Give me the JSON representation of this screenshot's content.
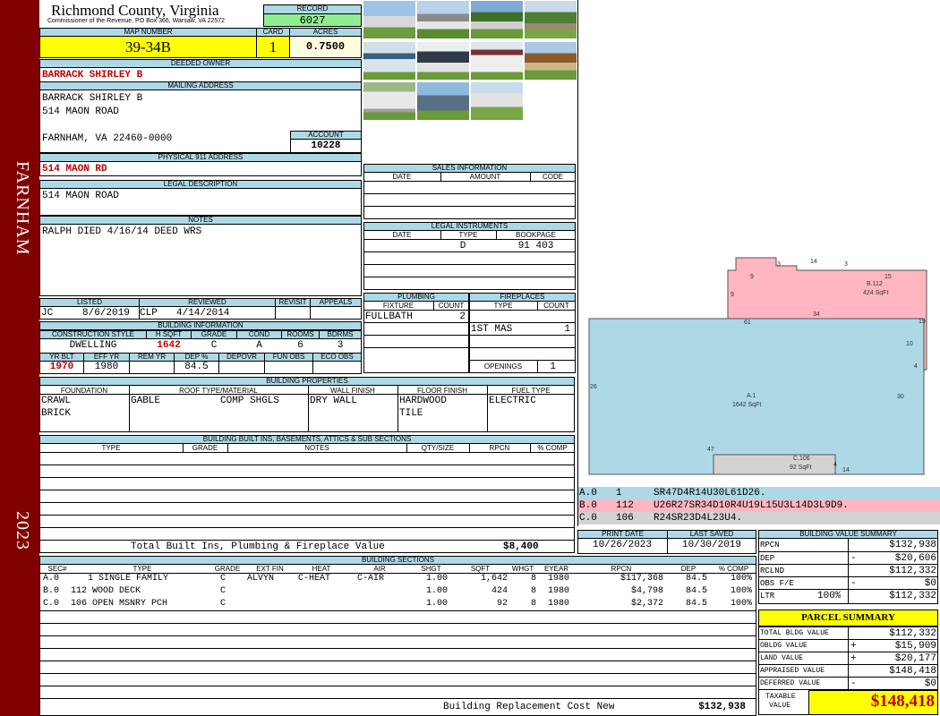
{
  "sidebar": {
    "town": "FARNHAM",
    "year": "2023"
  },
  "header": {
    "county": "Richmond County, Virginia",
    "commissioner": "Commissioner of the Revenue, PO Box 366, Warsaw, VA 22572",
    "record_label": "RECORD",
    "record": "6027"
  },
  "parcel": {
    "map_number_label": "MAP NUMBER",
    "map_number": "39-34B",
    "card_label": "CARD",
    "card": "1",
    "acres_label": "ACRES",
    "acres": "0.7500"
  },
  "owner": {
    "deeded_owner_label": "DEEDED OWNER",
    "deeded_owner": "BARRACK SHIRLEY B",
    "mailing_label": "MAILING ADDRESS",
    "mailing_line1": "BARRACK SHIRLEY B",
    "mailing_line2": "514 MAON ROAD",
    "mailing_line3": "FARNHAM, VA 22460-0000",
    "account_label": "ACCOUNT",
    "account": "10228"
  },
  "physical": {
    "label": "PHYSICAL 911 ADDRESS",
    "value": "514 MAON RD"
  },
  "legal": {
    "label": "LEGAL DESCRIPTION",
    "value": "514 MAON ROAD"
  },
  "notes": {
    "label": "NOTES",
    "value": "RALPH DIED 4/16/14 DEED WRS"
  },
  "review": {
    "listed_label": "LISTED",
    "reviewed_label": "REVIEWED",
    "revisit_label": "REVISIT",
    "appeals_label": "APPEALS",
    "listed_by": "JC",
    "listed_date": "8/6/2019",
    "reviewed_by": "CLP",
    "reviewed_date": "4/14/2014"
  },
  "building_info": {
    "label": "BUILDING INFORMATION",
    "construction_style_label": "CONSTRUCTION STYLE",
    "hsqft_label": "H SQFT",
    "grade_label": "GRADE",
    "cond_label": "COND",
    "rooms_label": "ROOMS",
    "bdrms_label": "BDRMS",
    "construction_style": "DWELLING",
    "hsqft": "1642",
    "grade": "C",
    "cond": "A",
    "rooms": "6",
    "bdrms": "3",
    "yrblt_label": "YR BLT",
    "effyr_label": "EFF YR",
    "remyr_label": "REM YR",
    "dep_label": "DEP %",
    "depovr_label": "DEPOVR",
    "funobs_label": "FUN OBS",
    "ecoobs_label": "ECO OBS",
    "yrblt": "1970",
    "effyr": "1980",
    "dep": "84.5"
  },
  "building_props": {
    "label": "BUILDING PROPERTIES",
    "foundation_label": "FOUNDATION",
    "roof_label": "ROOF TYPE/MATERIAL",
    "wall_label": "WALL FINISH",
    "floor_label": "FLOOR FINISH",
    "fuel_label": "FUEL TYPE",
    "foundation1": "CRAWL",
    "foundation2": "BRICK",
    "roof_type": "GABLE",
    "roof_material": "COMP SHGLS",
    "wall": "DRY WALL",
    "floor1": "HARDWOOD",
    "floor2": "TILE",
    "fuel": "ELECTRIC"
  },
  "builtins": {
    "label": "BUILDING BUILT INS, BASEMENTS, ATTICS & SUB SECTIONS",
    "type_label": "TYPE",
    "grade_label": "GRADE",
    "notes_label": "NOTES",
    "qty_label": "QTY/SIZE",
    "rpcn_label": "RPCN",
    "pcomp_label": "% COMP",
    "total_label": "Total Built Ins, Plumbing & Fireplace Value",
    "total_value": "$8,400"
  },
  "sales": {
    "label": "SALES INFORMATION",
    "date_label": "DATE",
    "amount_label": "AMOUNT",
    "code_label": "CODE"
  },
  "legal_instruments": {
    "label": "LEGAL INSTRUMENTS",
    "date_label": "DATE",
    "type_label": "TYPE",
    "bookpage_label": "BOOKPAGE",
    "type": "D",
    "bookpage": "91 403"
  },
  "plumbing": {
    "label": "PLUMBING",
    "fixture_label": "FIXTURE",
    "count_label": "COUNT",
    "fixture": "FULLBATH",
    "count": "2"
  },
  "fireplaces": {
    "label": "FIREPLACES",
    "type_label": "TYPE",
    "count_label": "COUNT",
    "type": "1ST MAS",
    "count": "1",
    "openings_label": "OPENINGS",
    "openings": "1"
  },
  "sketch": {
    "a_label": "A.1",
    "a_area": "1642 SqFt",
    "b_label": "B.112",
    "b_area": "424 SqFt",
    "c_label": "C.106",
    "c_area": "92 SqFt",
    "dims": {
      "a_top": "61",
      "a_left": "26",
      "a_right": "30",
      "a_bottom": "47",
      "b_left": "9",
      "b_top1": "9",
      "b_top2": "3",
      "b_top3": "14",
      "b_top4": "3",
      "b_right_top": "15",
      "b_right": "19",
      "b_r2": "10",
      "b_r3": "4",
      "b_mid": "34",
      "c_right": "4",
      "c_bottom": "14"
    },
    "a_color": "#add8e6",
    "b_color": "#ffb6c1",
    "c_color": "#d3d3d3"
  },
  "vectors": [
    {
      "sec": "A.0",
      "code": "1",
      "vec": "SR47D4R14U30L61D26."
    },
    {
      "sec": "B.0",
      "code": "112",
      "vec": "U26R27SR34D10R4U19L15U3L14D3L9D9."
    },
    {
      "sec": "C.0",
      "code": "106",
      "vec": "R24SR23D4L23U4."
    }
  ],
  "dates": {
    "print_label": "PRINT DATE",
    "saved_label": "LAST SAVED",
    "print": "10/26/2023",
    "saved": "10/30/2019"
  },
  "sections": {
    "label": "BUILDING SECTIONS",
    "headers": [
      "SEC#",
      "TYPE",
      "GRADE",
      "EXT FIN",
      "HEAT",
      "AIR",
      "SHGT",
      "SQFT",
      "WHGT",
      "EYEAR",
      "RPCN",
      "DEP",
      "% COMP"
    ],
    "rows": [
      [
        "A.0",
        "1 SINGLE FAMILY",
        "C",
        "ALVYN",
        "C-HEAT",
        "C-AIR",
        "1.00",
        "1,642",
        "8",
        "1980",
        "$117,368",
        "84.5",
        "100%"
      ],
      [
        "B.0",
        "112 WOOD DECK",
        "C",
        "",
        "",
        "",
        "1.00",
        "424",
        "8",
        "1980",
        "$4,798",
        "84.5",
        "100%"
      ],
      [
        "C.0",
        "106 OPEN MSNRY PCH",
        "C",
        "",
        "",
        "",
        "1.00",
        "92",
        "8",
        "1980",
        "$2,372",
        "84.5",
        "100%"
      ]
    ],
    "replacement_label": "Building Replacement Cost New",
    "replacement_value": "$132,938"
  },
  "value_summary": {
    "label": "BUILDING VALUE SUMMARY",
    "rpcn_label": "RPCN",
    "rpcn": "$132,938",
    "dep_label": "DEP",
    "dep_sign": "-",
    "dep": "$20,606",
    "rclnd_label": "RCLND",
    "rclnd": "$112,332",
    "obsfe_label": "OBS F/E",
    "obsfe_sign": "-",
    "obsfe": "$0",
    "ltr_label": "LTR",
    "ltr_pct": "100%",
    "ltr": "$112,332"
  },
  "parcel_summary": {
    "label": "PARCEL SUMMARY",
    "total_bldg_label": "TOTAL BLDG VALUE",
    "total_bldg": "$112,332",
    "obldg_label": "OBLDG VALUE",
    "obldg_sign": "+",
    "obldg": "$15,909",
    "land_label": "LAND VALUE",
    "land_sign": "+",
    "land": "$20,177",
    "appraised_label": "APPRAISED VALUE",
    "appraised": "$148,418",
    "deferred_label": "DEFERRED VALUE",
    "deferred_sign": "-",
    "deferred": "$0",
    "taxable_label1": "TAXABLE",
    "taxable_label2": "VALUE",
    "taxable": "$148,418"
  }
}
